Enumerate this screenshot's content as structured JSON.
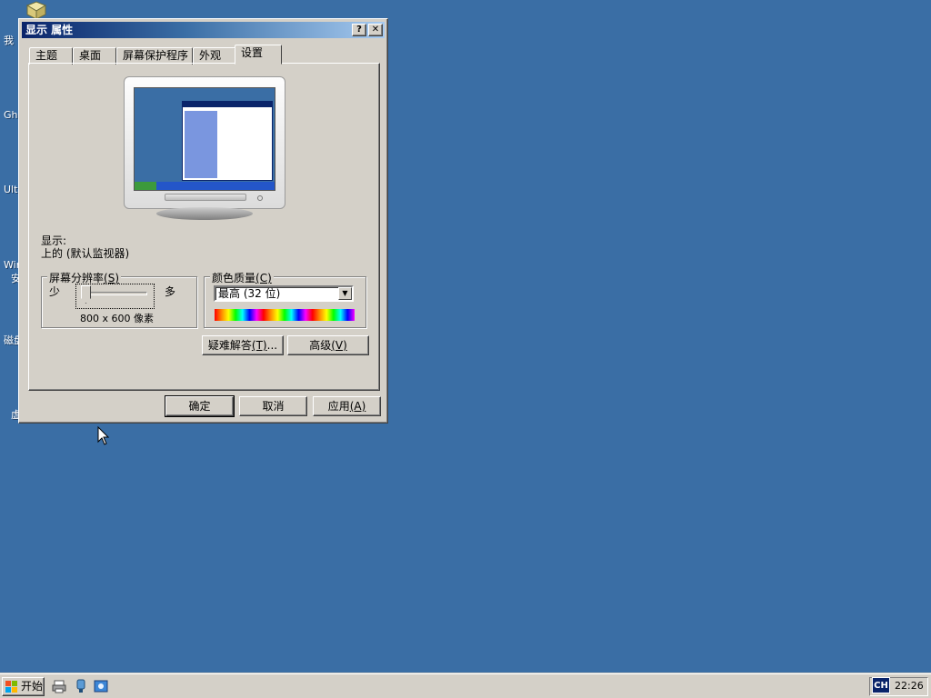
{
  "desktop": {
    "icon_fragments": [
      "我",
      "Gho",
      "Ultr",
      "Win",
      "安",
      "磁盘",
      "虚"
    ]
  },
  "dialog": {
    "title": "显示 属性",
    "help_glyph": "?",
    "close_glyph": "✕",
    "tabs": [
      {
        "label": "主题"
      },
      {
        "label": "桌面"
      },
      {
        "label": "屏幕保护程序"
      },
      {
        "label": "外观"
      },
      {
        "label": "设置",
        "active": true
      }
    ],
    "settings": {
      "display_label": "显示:",
      "display_value": "上的 (默认监视器)",
      "resolution_group": "屏幕分辨率",
      "resolution_hotkey": "(S)",
      "slider_min_label": "少",
      "slider_max_label": "多",
      "slider_level": 0,
      "resolution_value": "800 x 600 像素",
      "color_group": "颜色质量",
      "color_hotkey": "(C)",
      "color_quality_value": "最高 (32 位)",
      "troubleshoot_label": "疑难解答",
      "troubleshoot_hotkey": "(T)",
      "troubleshoot_suffix": "...",
      "advanced_label": "高级",
      "advanced_hotkey": "(V)"
    },
    "buttons": {
      "ok": "确定",
      "cancel": "取消",
      "apply": "应用",
      "apply_hotkey": "(A)"
    }
  },
  "taskbar": {
    "start_label": "开始",
    "language_indicator": "CH",
    "clock": "22:26"
  },
  "colors": {
    "desktop_bg": "#3a6ea5",
    "titlebar_start": "#0a246a",
    "titlebar_end": "#a6caf0",
    "face": "#d4d0c8"
  }
}
